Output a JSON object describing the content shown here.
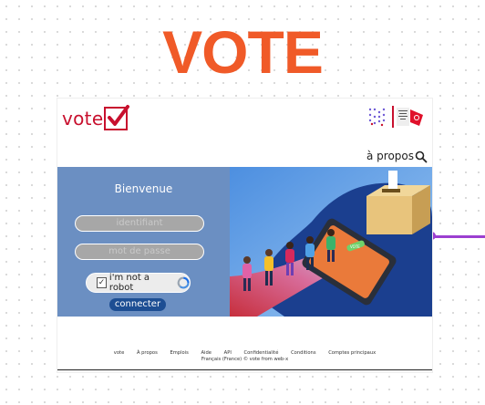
{
  "hero": {
    "title": "VOTE"
  },
  "header": {
    "logo_text": "vote",
    "about": "à propos"
  },
  "login": {
    "welcome": "Bienvenue",
    "username_placeholder": "identifiant",
    "password_placeholder": "mot de passe",
    "captcha_label": "i'm not a robot",
    "connect_button": "connecter"
  },
  "illustration": {
    "screen_button": "VOTE"
  },
  "footer": {
    "links": [
      "vote",
      "À propos",
      "Emplois",
      "Aide",
      "API",
      "Confidentialité",
      "Conditions",
      "Comptes principaux"
    ],
    "language": "Français (France)",
    "copyright": "© vote from web-x"
  },
  "colors": {
    "accent": "#f05a28",
    "brand_red": "#c8102e",
    "panel_blue": "#6b8fc2",
    "button_blue": "#1d4e93",
    "connector": "#9b3fd0"
  }
}
